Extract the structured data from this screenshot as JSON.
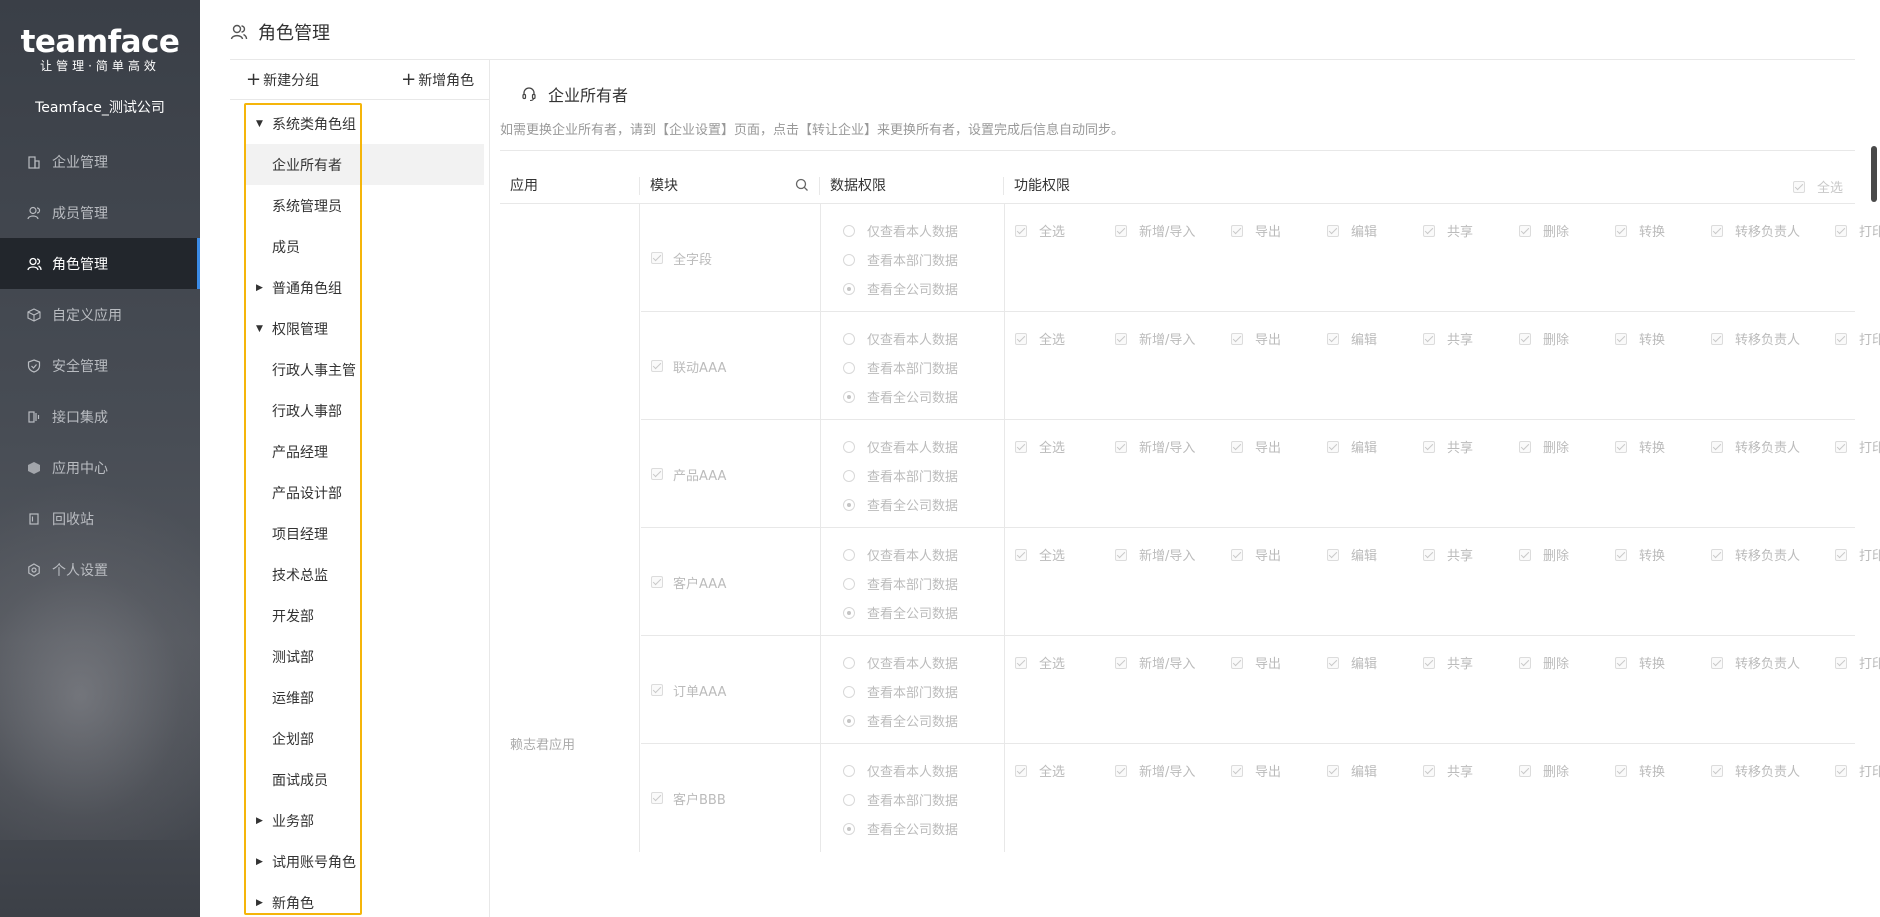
{
  "sidebar": {
    "brand": "teamface",
    "slogan": "让管理·简单高效",
    "company": "Teamface_测试公司",
    "items": [
      {
        "label": "企业管理",
        "icon": "building-icon"
      },
      {
        "label": "成员管理",
        "icon": "users-icon"
      },
      {
        "label": "角色管理",
        "icon": "role-icon",
        "active": true
      },
      {
        "label": "自定义应用",
        "icon": "cube-icon"
      },
      {
        "label": "安全管理",
        "icon": "shield-icon"
      },
      {
        "label": "接口集成",
        "icon": "plug-icon"
      },
      {
        "label": "应用中心",
        "icon": "box-icon"
      },
      {
        "label": "回收站",
        "icon": "trash-icon"
      },
      {
        "label": "个人设置",
        "icon": "gear-icon"
      }
    ]
  },
  "header": {
    "title": "角色管理"
  },
  "role_panel": {
    "new_group": "新建分组",
    "new_role": "新增角色",
    "tree": [
      {
        "label": "系统类角色组",
        "type": "group",
        "expanded": true
      },
      {
        "label": "企业所有者",
        "type": "leaf",
        "selected": true
      },
      {
        "label": "系统管理员",
        "type": "leaf"
      },
      {
        "label": "成员",
        "type": "leaf"
      },
      {
        "label": "普通角色组",
        "type": "group",
        "expanded": false
      },
      {
        "label": "权限管理",
        "type": "group",
        "expanded": true
      },
      {
        "label": "行政人事主管",
        "type": "leaf"
      },
      {
        "label": "行政人事部",
        "type": "leaf"
      },
      {
        "label": "产品经理",
        "type": "leaf"
      },
      {
        "label": "产品设计部",
        "type": "leaf"
      },
      {
        "label": "项目经理",
        "type": "leaf"
      },
      {
        "label": "技术总监",
        "type": "leaf"
      },
      {
        "label": "开发部",
        "type": "leaf"
      },
      {
        "label": "测试部",
        "type": "leaf"
      },
      {
        "label": "运维部",
        "type": "leaf"
      },
      {
        "label": "企划部",
        "type": "leaf"
      },
      {
        "label": "面试成员",
        "type": "leaf"
      },
      {
        "label": "业务部",
        "type": "group",
        "expanded": false
      },
      {
        "label": "试用账号角色",
        "type": "group",
        "expanded": false
      },
      {
        "label": "新角色",
        "type": "group",
        "expanded": false
      }
    ]
  },
  "content": {
    "title": "企业所有者",
    "hint": "如需更换企业所有者，请到【企业设置】页面，点击【转让企业】来更换所有者，设置完成后信息自动同步。",
    "columns": {
      "app": "应用",
      "module": "模块",
      "data": "数据权限",
      "func": "功能权限",
      "select_all": "全选"
    },
    "app_name": "赖志君应用",
    "data_options": [
      "仅查看本人数据",
      "查看本部门数据",
      "查看全公司数据"
    ],
    "func_options": [
      "全选",
      "新增/导入",
      "导出",
      "编辑",
      "共享",
      "删除",
      "转换",
      "转移负责人",
      "打印"
    ],
    "modules": [
      "全字段",
      "联动AAA",
      "产品AAA",
      "客户AAA",
      "订单AAA",
      "客户BBB"
    ]
  }
}
